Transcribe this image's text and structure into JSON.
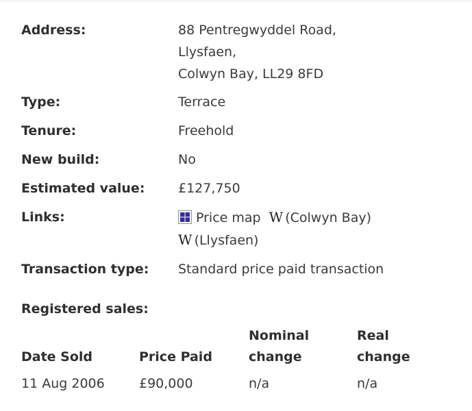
{
  "property": {
    "address_label": "Address:",
    "address_lines": [
      "88 Pentregwyddel Road,",
      "Llysfaen,",
      "Colwyn Bay, LL29 8FD"
    ],
    "type_label": "Type:",
    "type_value": "Terrace",
    "tenure_label": "Tenure:",
    "tenure_value": "Freehold",
    "new_build_label": "New build:",
    "new_build_value": "No",
    "estimated_value_label": "Estimated value:",
    "estimated_value": "£127,750",
    "links_label": "Links:",
    "links": {
      "price_map": "Price map",
      "wiki_symbol": "W",
      "wiki_colwyn_bay": "(Colwyn Bay)",
      "wiki_llysfaen": "(Llysfaen)"
    },
    "transaction_type_label": "Transaction type:",
    "transaction_type_value": "Standard price paid transaction"
  },
  "sales": {
    "title": "Registered sales:",
    "headers": {
      "date_sold": "Date Sold",
      "price_paid": "Price Paid",
      "nominal_change_1": "Nominal",
      "nominal_change_2": "change",
      "real_change_1": "Real",
      "real_change_2": "change"
    },
    "rows": [
      {
        "date_sold": "11 Aug 2006",
        "price_paid": "£90,000",
        "nominal_change": "n/a",
        "real_change": "n/a"
      }
    ]
  },
  "icons": {
    "price_map": "price-map-icon",
    "wikipedia": "wikipedia-icon"
  }
}
